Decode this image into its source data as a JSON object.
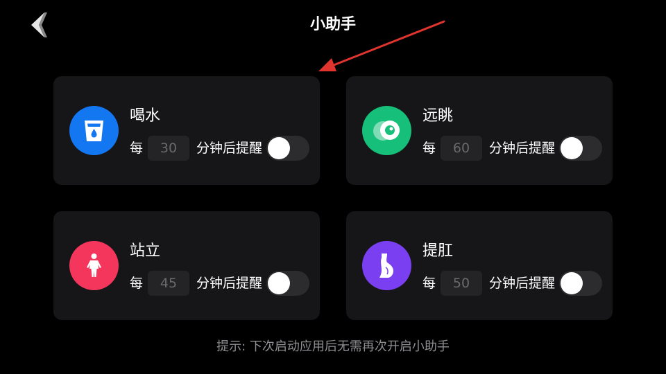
{
  "header": {
    "title": "小助手"
  },
  "colors": {
    "background": "#000000",
    "card": "#161618",
    "water": "#1477f2",
    "eye": "#16c07a",
    "stand": "#f5365c",
    "kegel": "#7b3ff2",
    "annotation": "#e0342f"
  },
  "icons": {
    "back": "chevron-left-icon",
    "water": "water-cup-icon",
    "eye": "eye-icon",
    "stand": "person-standing-icon",
    "kegel": "body-silhouette-icon"
  },
  "reminders": [
    {
      "title": "喝水",
      "prefix": "每",
      "minutes": "30",
      "suffix": "分钟后提醒",
      "enabled": false
    },
    {
      "title": "远眺",
      "prefix": "每",
      "minutes": "60",
      "suffix": "分钟后提醒",
      "enabled": false
    },
    {
      "title": "站立",
      "prefix": "每",
      "minutes": "45",
      "suffix": "分钟后提醒",
      "enabled": false
    },
    {
      "title": "提肛",
      "prefix": "每",
      "minutes": "50",
      "suffix": "分钟后提醒",
      "enabled": false
    }
  ],
  "footer": {
    "hint": "提示: 下次启动应用后无需再次开启小助手"
  }
}
